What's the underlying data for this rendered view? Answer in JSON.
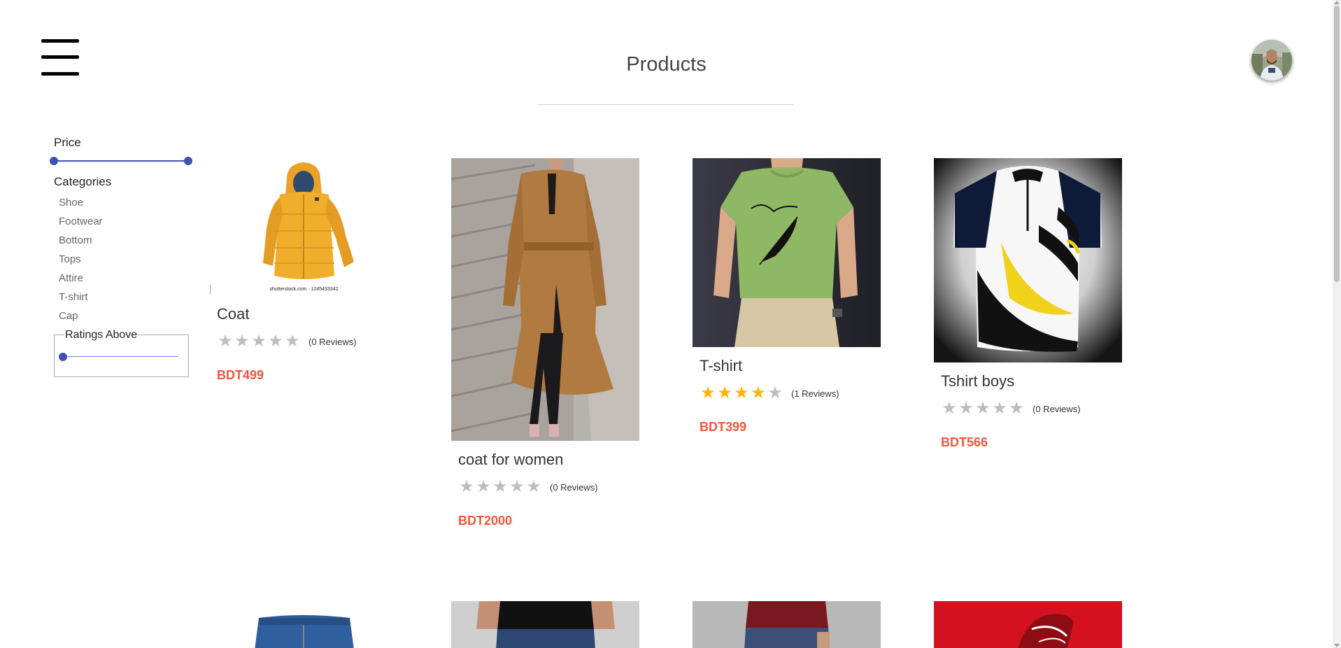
{
  "header": {
    "title": "Products",
    "menu_icon": "hamburger-menu-icon",
    "avatar": "user-avatar"
  },
  "filters": {
    "price_heading": "Price",
    "price_range": [
      0,
      1
    ],
    "categories_heading": "Categories",
    "categories": [
      "Shoe",
      "Footwear",
      "Bottom",
      "Tops",
      "Attire",
      "T-shirt",
      "Cap"
    ],
    "ratings_heading": "Ratings Above",
    "ratings_value": 0,
    "accent_color": "#3f51b5"
  },
  "products": [
    {
      "name": "Coat",
      "rating": 0,
      "reviews": "(0 Reviews)",
      "price": "BDT499",
      "image": "yellow-puffer-jacket",
      "image_caption": "shutterstock.com · 1245433342"
    },
    {
      "name": "coat for women",
      "rating": 0,
      "reviews": "(0 Reviews)",
      "price": "BDT2000",
      "image": "woman-camel-trench-coat"
    },
    {
      "name": "T-shirt",
      "rating": 4,
      "reviews": "(1 Reviews)",
      "price": "BDT399",
      "image": "green-feather-tshirt"
    },
    {
      "name": "Tshirt boys",
      "rating": 0,
      "reviews": "(0 Reviews)",
      "price": "BDT566",
      "image": "black-white-yellow-jersey"
    }
  ],
  "second_row_images": [
    "blue-jeans",
    "jeans-black-top",
    "jeans-maroon-top",
    "red-sneaker"
  ],
  "colors": {
    "price": "#f0573b",
    "star_filled": "#ffb400",
    "star_empty": "#bdbdbd"
  }
}
